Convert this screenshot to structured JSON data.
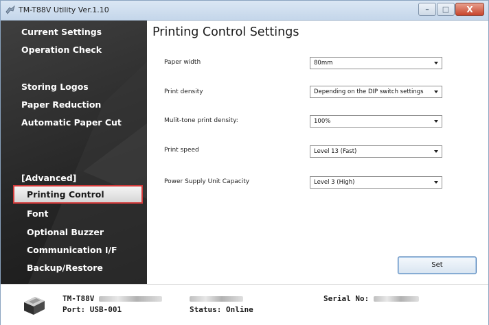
{
  "window": {
    "title": "TM-T88V Utility Ver.1.10",
    "buttons": {
      "minimize": "–",
      "maximize": "□",
      "close": "X"
    }
  },
  "sidebar": {
    "items": [
      {
        "label": "Current Settings"
      },
      {
        "label": "Operation Check"
      },
      {
        "label": "Storing Logos"
      },
      {
        "label": "Paper Reduction"
      },
      {
        "label": "Automatic Paper Cut"
      },
      {
        "label": "[Advanced]"
      },
      {
        "label": "Printing Control",
        "selected": true
      },
      {
        "label": "Font"
      },
      {
        "label": "Optional Buzzer"
      },
      {
        "label": "Communication I/F"
      },
      {
        "label": "Backup/Restore"
      }
    ]
  },
  "main": {
    "title": "Printing Control Settings",
    "settings": [
      {
        "label": "Paper width",
        "value": "80mm"
      },
      {
        "label": "Print density",
        "value": "Depending on the DIP switch settings"
      },
      {
        "label": "Mulit-tone print density:",
        "value": "100%"
      },
      {
        "label": "Print speed",
        "value": "Level 13 (Fast)"
      },
      {
        "label": "Power Supply Unit Capacity",
        "value": "Level 3 (High)"
      }
    ],
    "set_button": "Set"
  },
  "status": {
    "model": "TM-T88V",
    "port": "Port: USB-001",
    "status": "Status: Online",
    "serial_label": "Serial No:"
  },
  "colors": {
    "sidebar_bg": "#262626",
    "selection_border": "#d23a3a",
    "button_border": "#4f7fb5"
  }
}
